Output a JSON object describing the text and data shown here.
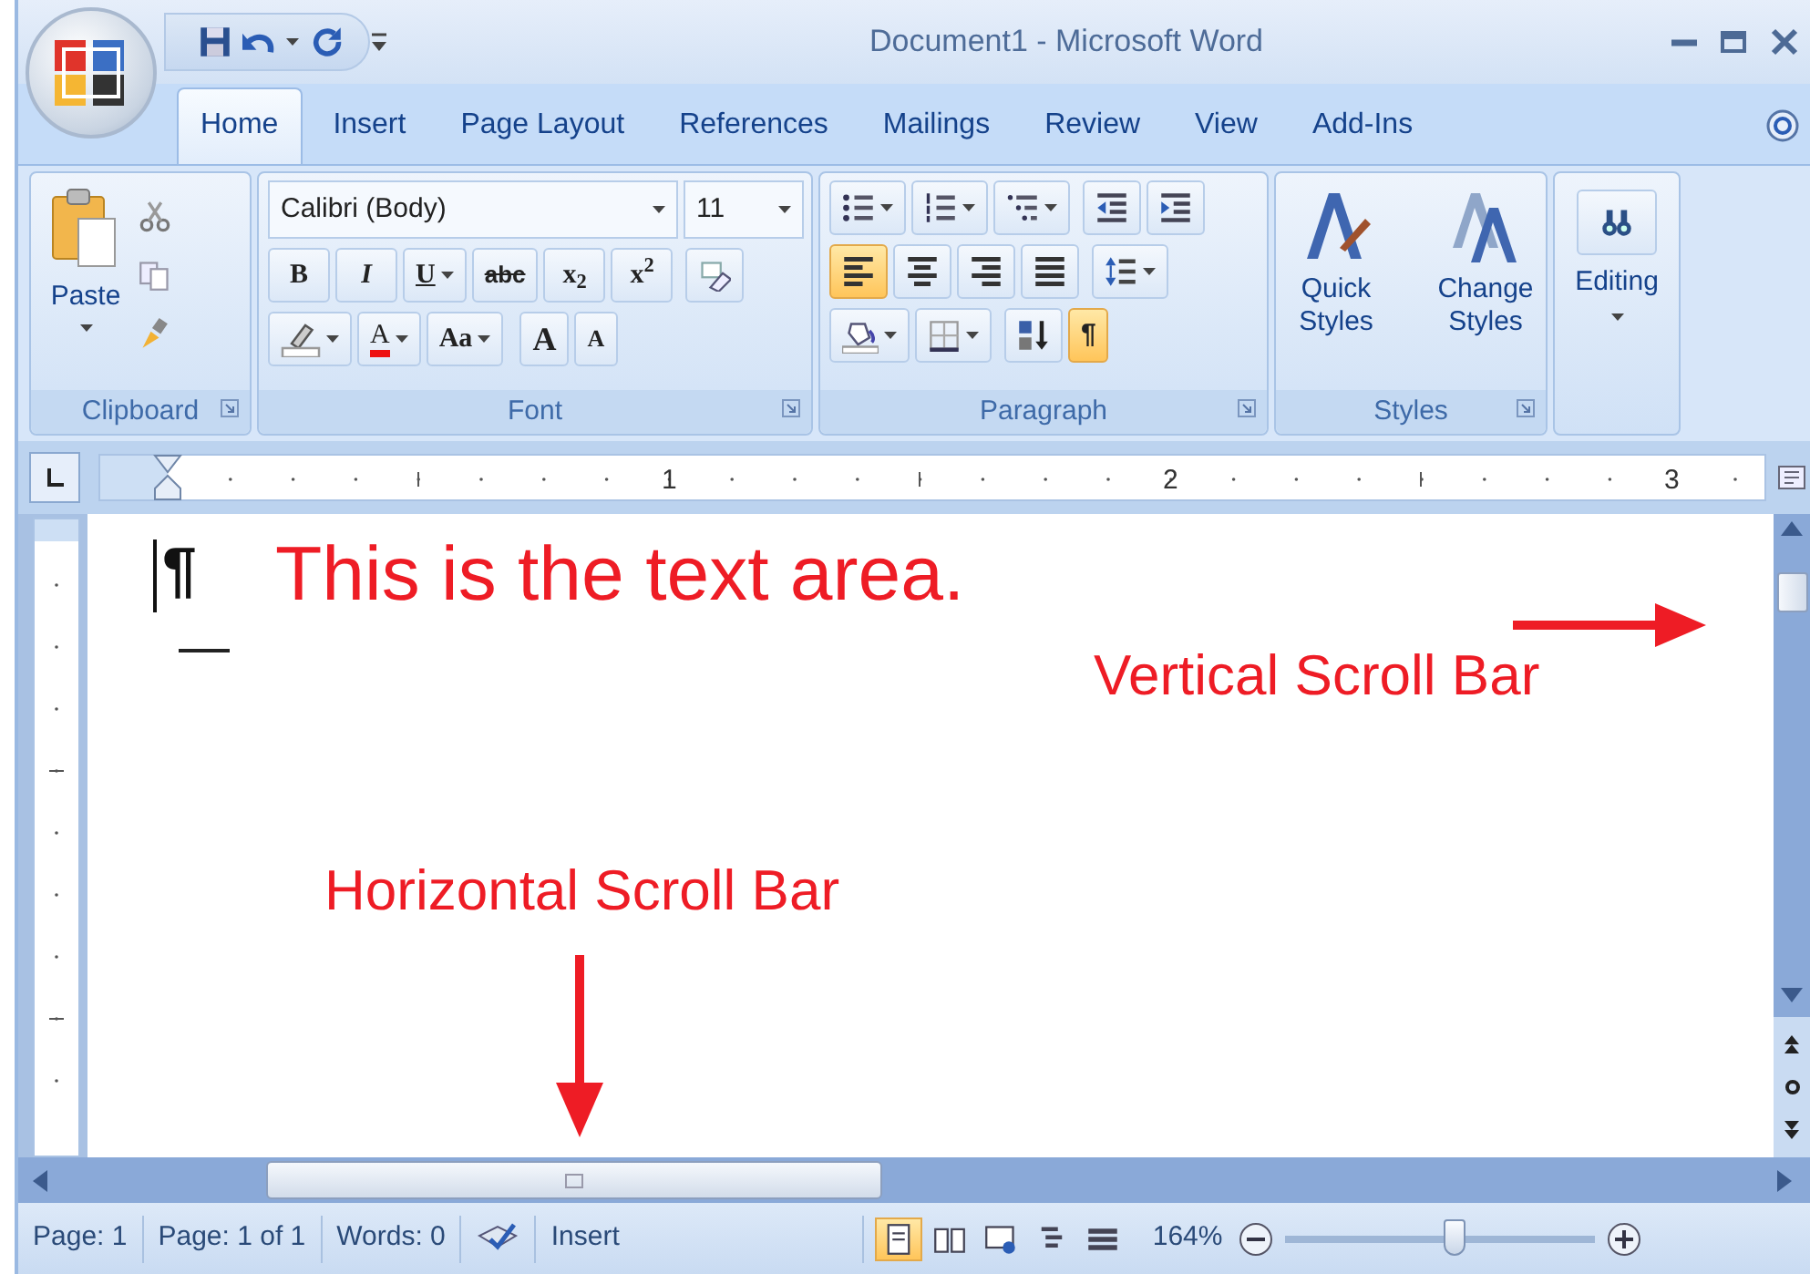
{
  "window": {
    "title": "Document1 - Microsoft Word"
  },
  "tabs": [
    {
      "label": "Home",
      "selected": true
    },
    {
      "label": "Insert",
      "selected": false
    },
    {
      "label": "Page Layout",
      "selected": false
    },
    {
      "label": "References",
      "selected": false
    },
    {
      "label": "Mailings",
      "selected": false
    },
    {
      "label": "Review",
      "selected": false
    },
    {
      "label": "View",
      "selected": false
    },
    {
      "label": "Add-Ins",
      "selected": false
    }
  ],
  "clipboard": {
    "label": "Clipboard",
    "paste": "Paste"
  },
  "font": {
    "label": "Font",
    "name": "Calibri (Body)",
    "size": "11",
    "format_buttons": [
      {
        "kind": "bold",
        "label": "B"
      },
      {
        "kind": "italic",
        "label": "I"
      },
      {
        "kind": "underline",
        "label": "U"
      },
      {
        "kind": "strike",
        "label": "abc"
      },
      {
        "kind": "sub",
        "label": "x$_{2}$"
      },
      {
        "kind": "sup",
        "label": "x$^{2}$"
      }
    ],
    "color_button": "A",
    "case_button": "Aa",
    "grow_button": "A",
    "shrink_button": "A"
  },
  "paragraph": {
    "label": "Paragraph",
    "alignments": [
      {
        "kind": "left",
        "selected": true
      },
      {
        "kind": "center",
        "selected": false
      },
      {
        "kind": "right",
        "selected": false
      },
      {
        "kind": "justify",
        "selected": false
      }
    ],
    "show_marks": {
      "label": "¶",
      "on": true
    }
  },
  "styles": {
    "label": "Styles",
    "buttons": [
      "Quick Styles",
      "Change Styles"
    ]
  },
  "editing": {
    "label": "Editing"
  },
  "ruler": {
    "numbers": [
      "1",
      "2",
      "3"
    ]
  },
  "document": {
    "mark": "¶",
    "annotations": [
      {
        "kind": "title",
        "text": "This is the text area."
      },
      {
        "kind": "right",
        "text": "Vertical Scroll Bar"
      },
      {
        "kind": "bottom",
        "text": "Horizontal Scroll Bar"
      }
    ]
  },
  "status_bar": {
    "items": [
      "Page: 1",
      "Page: 1 of 1",
      "Words: 0"
    ],
    "mode": "Insert",
    "views": [
      {
        "kind": "print",
        "selected": true
      },
      {
        "kind": "reading",
        "selected": false
      },
      {
        "kind": "web",
        "selected": false
      },
      {
        "kind": "outline",
        "selected": false
      },
      {
        "kind": "draft",
        "selected": false
      }
    ],
    "zoom": {
      "reading": "164%",
      "level": 0.55
    }
  }
}
